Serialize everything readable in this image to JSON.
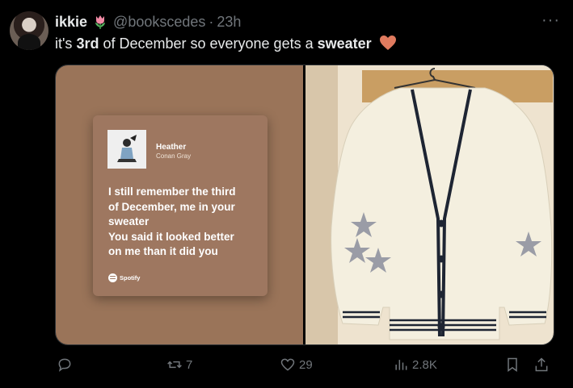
{
  "tweet": {
    "name": "ikkie",
    "handle": "@bookscedes",
    "separator": "·",
    "time": "23h",
    "more": "···",
    "text_before": "it's ",
    "text_bold1": "3rd",
    "text_mid": " of December so everyone gets a ",
    "text_bold2": "sweater",
    "heart_color": "#e07b5f"
  },
  "media": {
    "card": {
      "song_title": "Heather",
      "artist": "Conan Gray",
      "lyrics": [
        "I still remember the third",
        "of December, me in your",
        "sweater",
        "You said it looked better",
        "on me than it did you"
      ],
      "brand": "Spotify",
      "background": "#9a7459"
    },
    "photo": {
      "subject": "cream cable-knit cardigan with grey star patches on a hanger"
    }
  },
  "actions": {
    "reply_count": "",
    "retweet_count": "7",
    "like_count": "29",
    "views_count": "2.8K"
  }
}
